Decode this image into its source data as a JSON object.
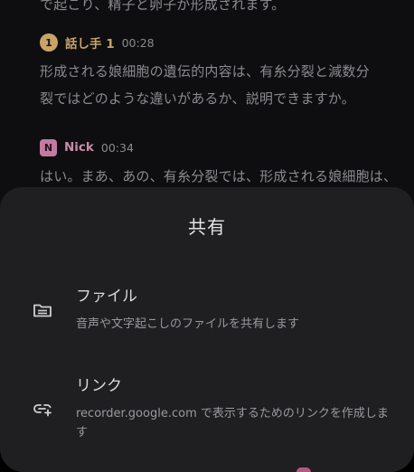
{
  "transcript": {
    "previous_line": "で起こり、精子と卵子が形成されます。",
    "entries": [
      {
        "speaker_badge": "1",
        "speaker_name": "話し手 1",
        "timestamp": "00:28",
        "lines": [
          "形成される娘細胞の遺伝的内容は、有糸分裂と減数分",
          "裂ではどのような違いがあるか、説明できますか。"
        ]
      },
      {
        "speaker_badge": "N",
        "speaker_name": "Nick",
        "timestamp": "00:34",
        "lines": [
          "はい。まあ、あの、有糸分裂では、形成される娘細胞は、"
        ]
      }
    ]
  },
  "share_sheet": {
    "title": "共有",
    "options": [
      {
        "icon": "folder-icon",
        "label": "ファイル",
        "description": "音声や文字起こしのファイルを共有します"
      },
      {
        "icon": "add-link-icon",
        "label": "リンク",
        "description": "recorder.google.com で表示するためのリンクを作成します"
      }
    ]
  },
  "colors": {
    "speaker1": "#c9a46a",
    "speaker2": "#c78aa8",
    "sheet_bg": "#1f1f22",
    "screen_bg": "#0e0e10"
  }
}
